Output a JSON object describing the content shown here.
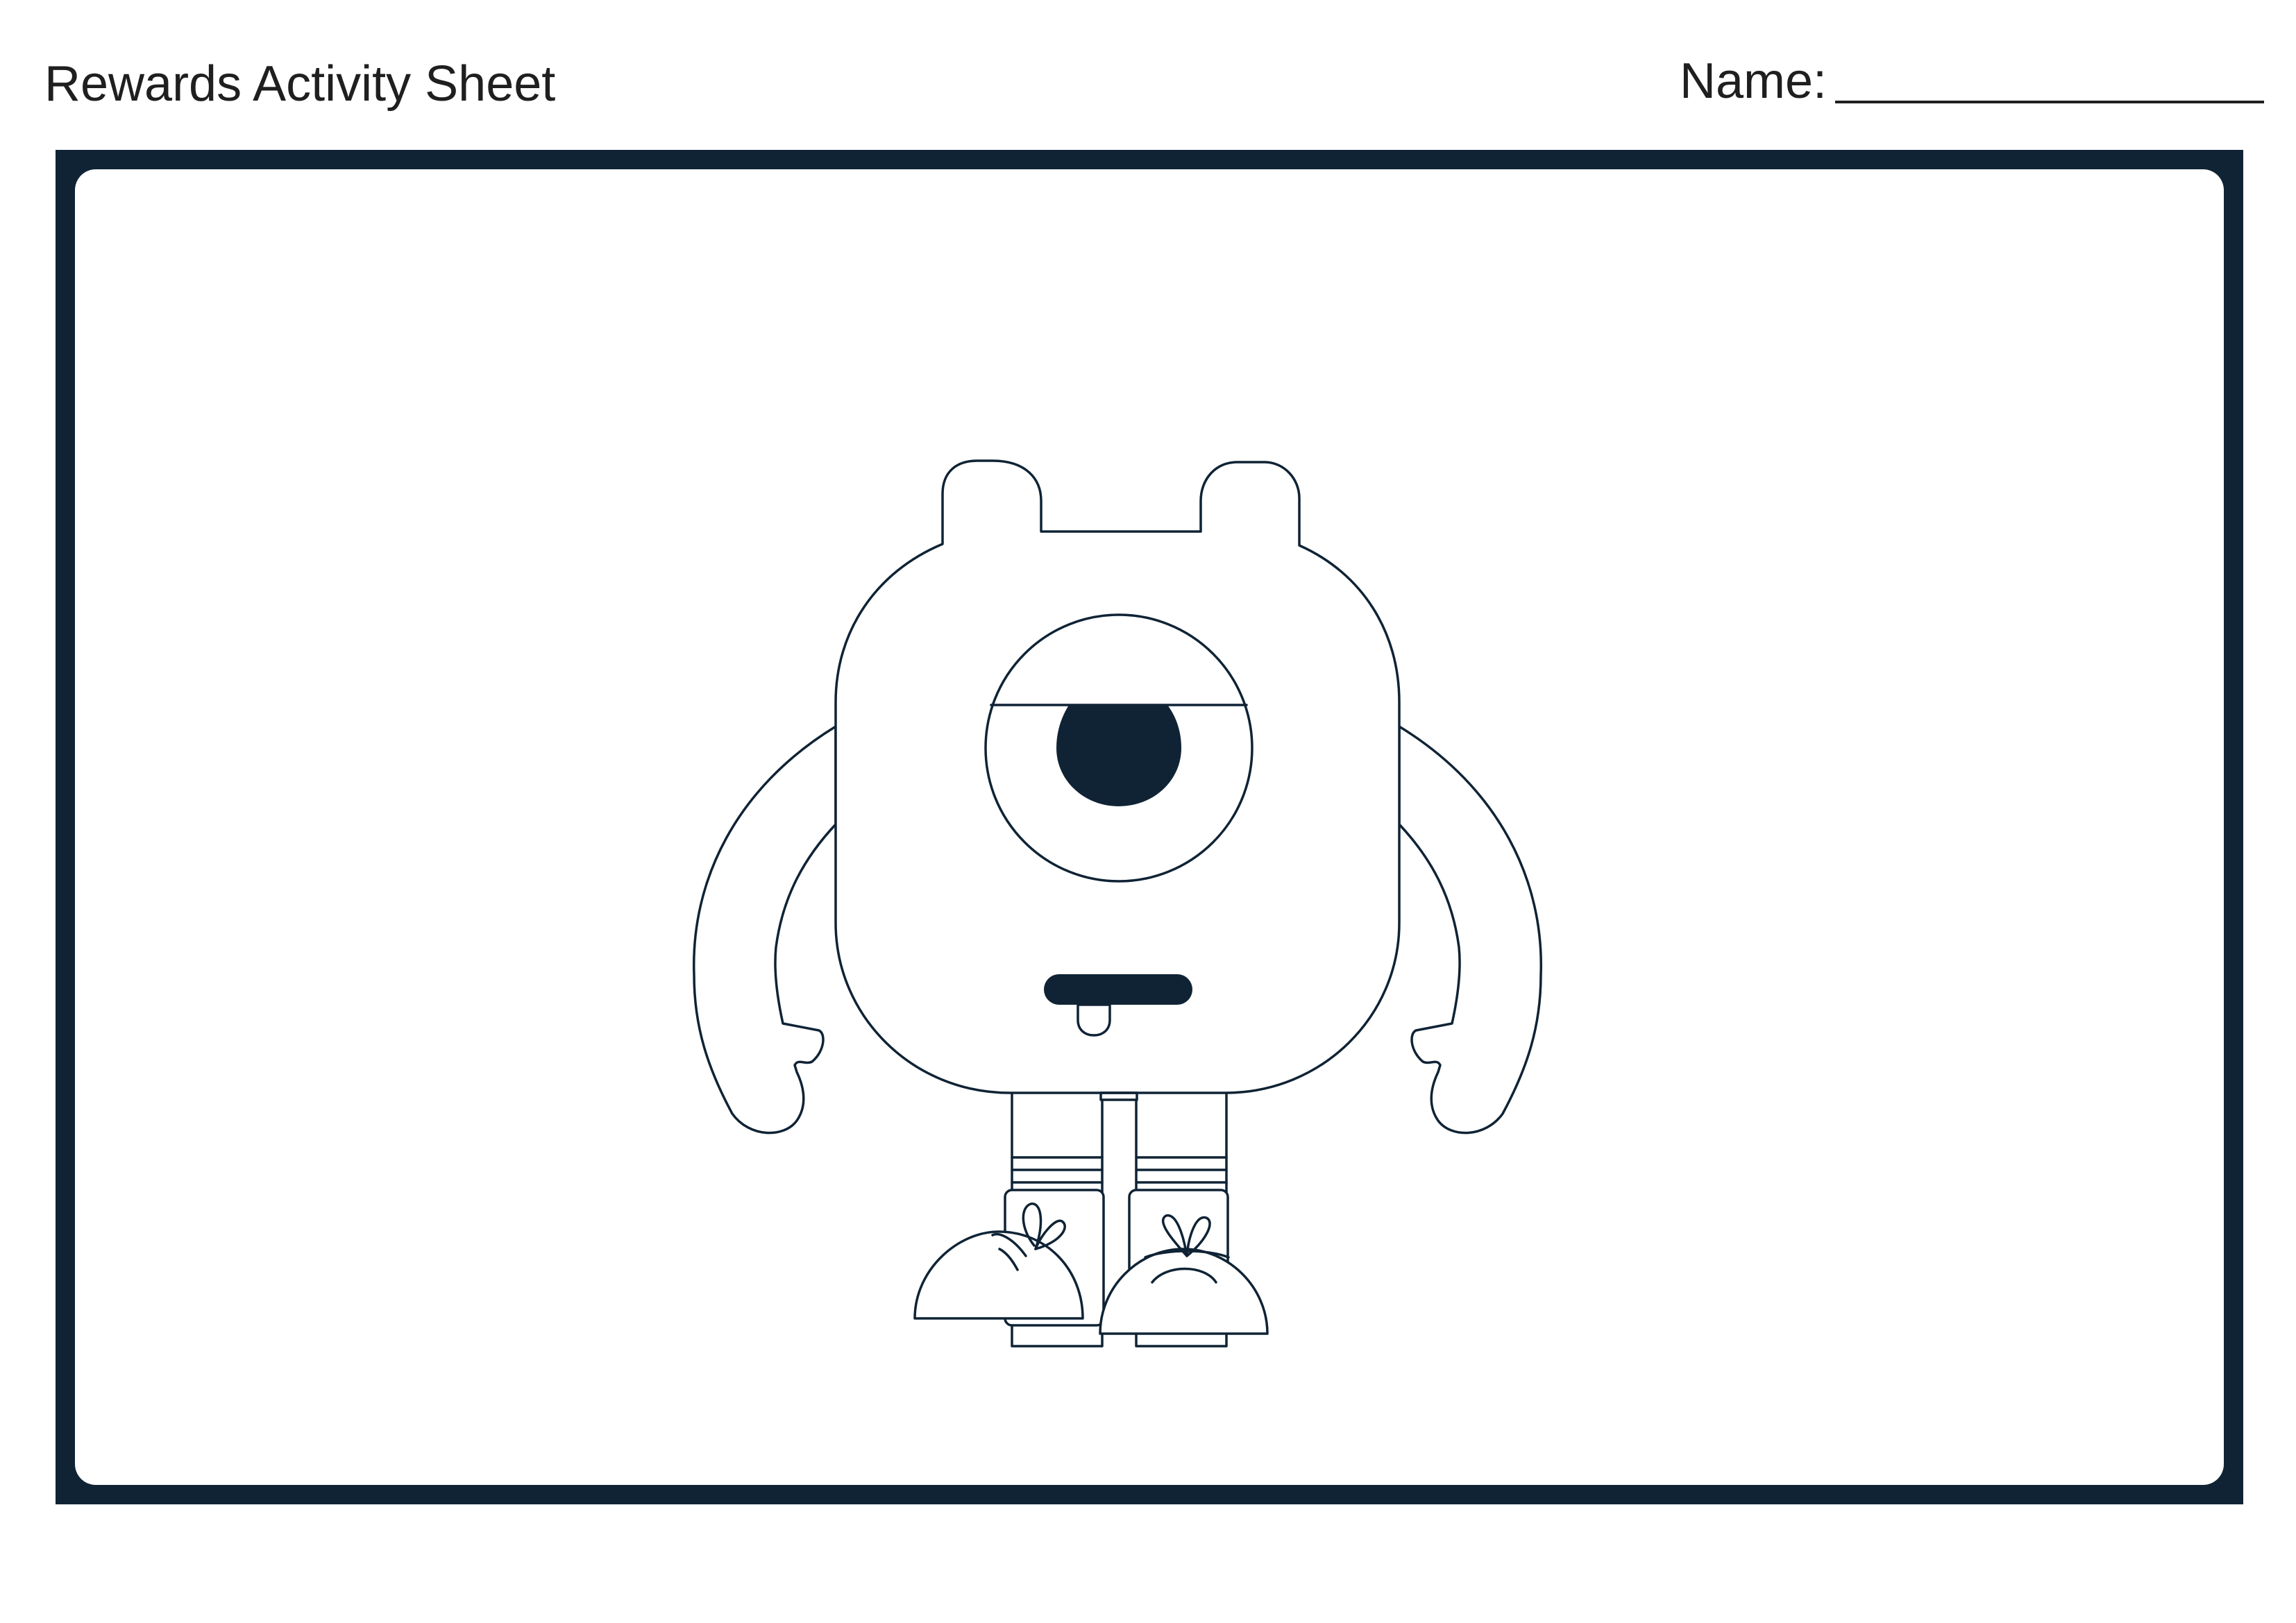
{
  "header": {
    "title": "Rewards Activity Sheet",
    "name_label": "Name:"
  },
  "colors": {
    "frame": "#0f2335",
    "outline": "#0f2335",
    "text": "#1f1f1f"
  },
  "illustration": {
    "subject": "one-eyed-monster-outline"
  }
}
